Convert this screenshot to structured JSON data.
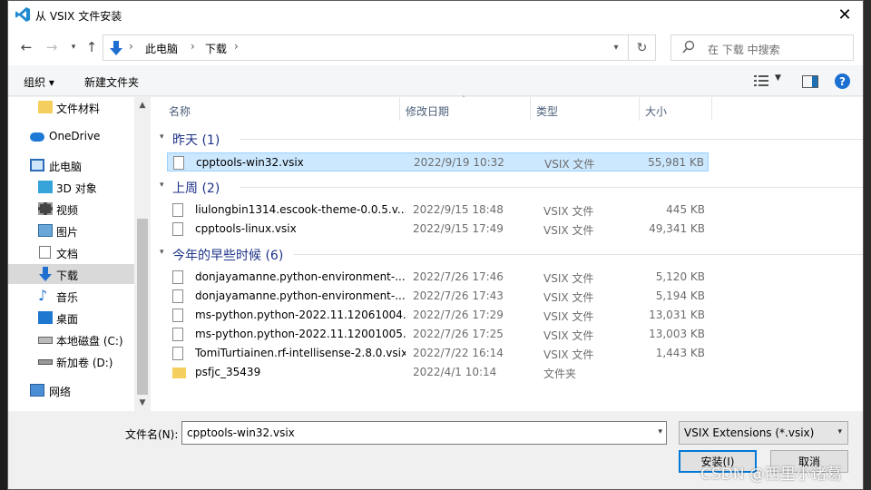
{
  "window": {
    "title": "从 VSIX 文件安装"
  },
  "nav": {
    "crumbs": [
      "此电脑",
      "下载"
    ],
    "search_placeholder": "在 下载 中搜索"
  },
  "toolbar": {
    "organize": "组织 ▾",
    "new_folder": "新建文件夹"
  },
  "sidebar": {
    "items": [
      {
        "label": "文件材料",
        "icon": "folder-icon"
      },
      {
        "label": "OneDrive",
        "icon": "cloud-icon"
      },
      {
        "label": "此电脑",
        "icon": "computer-icon"
      },
      {
        "label": "3D 对象",
        "icon": "3d-objects-icon"
      },
      {
        "label": "视频",
        "icon": "video-icon"
      },
      {
        "label": "图片",
        "icon": "pictures-icon"
      },
      {
        "label": "文档",
        "icon": "documents-icon"
      },
      {
        "label": "下载",
        "icon": "download-icon"
      },
      {
        "label": "音乐",
        "icon": "music-icon"
      },
      {
        "label": "桌面",
        "icon": "desktop-icon"
      },
      {
        "label": "本地磁盘 (C:)",
        "icon": "drive-icon"
      },
      {
        "label": "新加卷 (D:)",
        "icon": "drive-icon"
      },
      {
        "label": "网络",
        "icon": "network-icon"
      }
    ]
  },
  "columns": {
    "name": "名称",
    "date": "修改日期",
    "type": "类型",
    "size": "大小"
  },
  "groups": [
    {
      "label": "昨天 (1)",
      "files": [
        {
          "name": "cpptools-win32.vsix",
          "date": "2022/9/19 10:32",
          "type": "VSIX 文件",
          "size": "55,981 KB"
        }
      ]
    },
    {
      "label": "上周 (2)",
      "files": [
        {
          "name": "liulongbin1314.escook-theme-0.0.5.v...",
          "date": "2022/9/15 18:48",
          "type": "VSIX 文件",
          "size": "445 KB"
        },
        {
          "name": "cpptools-linux.vsix",
          "date": "2022/9/15 17:49",
          "type": "VSIX 文件",
          "size": "49,341 KB"
        }
      ]
    },
    {
      "label": "今年的早些时候 (6)",
      "files": [
        {
          "name": "donjayamanne.python-environment-...",
          "date": "2022/7/26 17:46",
          "type": "VSIX 文件",
          "size": "5,120 KB"
        },
        {
          "name": "donjayamanne.python-environment-...",
          "date": "2022/7/26 17:43",
          "type": "VSIX 文件",
          "size": "5,194 KB"
        },
        {
          "name": "ms-python.python-2022.11.12061004....",
          "date": "2022/7/26 17:29",
          "type": "VSIX 文件",
          "size": "13,031 KB"
        },
        {
          "name": "ms-python.python-2022.11.12001005....",
          "date": "2022/7/26 17:25",
          "type": "VSIX 文件",
          "size": "13,003 KB"
        },
        {
          "name": "TomiTurtiainen.rf-intellisense-2.8.0.vsix",
          "date": "2022/7/22 16:14",
          "type": "VSIX 文件",
          "size": "1,443 KB"
        },
        {
          "name": "psfjc_35439",
          "date": "2022/4/1 10:14",
          "type": "文件夹",
          "size": ""
        }
      ]
    }
  ],
  "bottom": {
    "filename_label": "文件名(N):",
    "filename_value": "cpptools-win32.vsix",
    "filetype_value": "VSIX Extensions (*.vsix)",
    "install_label": "安装(I)",
    "cancel_label": "取消"
  },
  "watermark": "CSDN @西里小诸葛"
}
